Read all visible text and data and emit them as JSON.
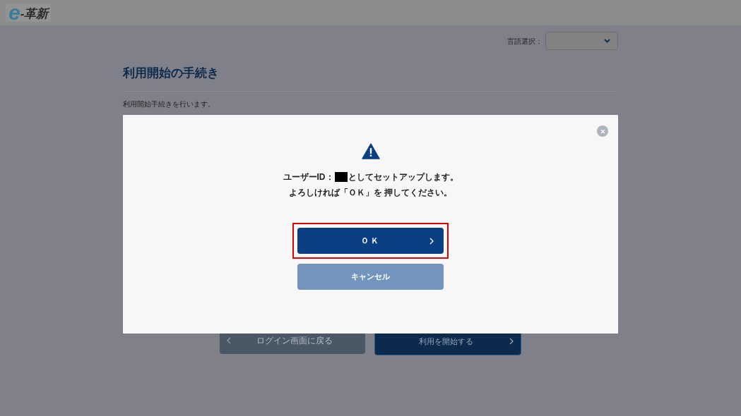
{
  "header": {
    "logo_e": "e",
    "logo_text": "-革新"
  },
  "language": {
    "label": "言語選択："
  },
  "page": {
    "title": "利用開始の手続き",
    "description": "利用開始手続きを行います。",
    "buttons": [
      {
        "kind": "back",
        "label": "ログイン画面に戻る"
      },
      {
        "kind": "next",
        "label": "利用を開始する"
      }
    ]
  },
  "dialog": {
    "message_before_id": "ユーザーID：",
    "message_after_id": "としてセットアップします。",
    "message_line_2": "よろしければ「ＯＫ」を 押してください。",
    "buttons": [
      {
        "kind": "primary",
        "label": "ＯＫ",
        "highlighted": true
      },
      {
        "kind": "secondary",
        "label": "キャンセル",
        "highlighted": false
      }
    ]
  }
}
